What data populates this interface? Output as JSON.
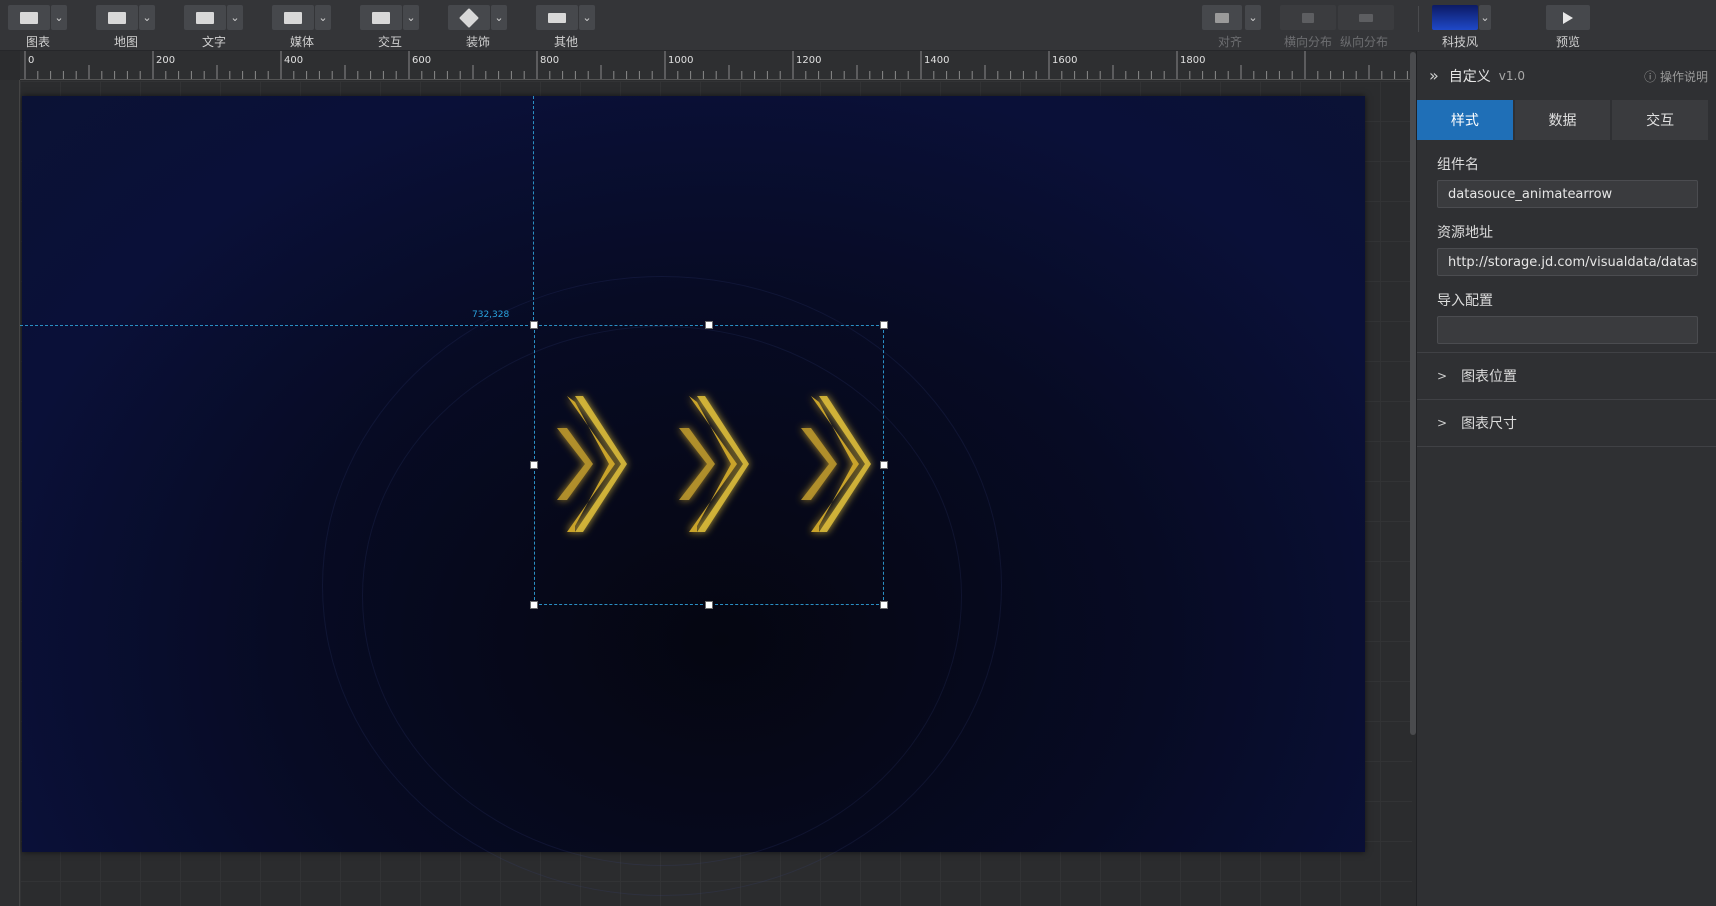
{
  "toolbar": {
    "tools": [
      {
        "label": "图表",
        "icon": "chart-icon"
      },
      {
        "label": "地图",
        "icon": "map-icon"
      },
      {
        "label": "文字",
        "icon": "text-icon"
      },
      {
        "label": "媒体",
        "icon": "media-icon"
      },
      {
        "label": "交互",
        "icon": "interaction-icon"
      },
      {
        "label": "装饰",
        "icon": "decoration-icon"
      },
      {
        "label": "其他",
        "icon": "more-icon"
      }
    ],
    "align_label": "对齐",
    "hdist_label": "横向分布",
    "vdist_label": "纵向分布",
    "theme_label": "科技风",
    "preview_label": "预览"
  },
  "ruler": {
    "ticks": [
      "0",
      "200",
      "400",
      "600",
      "800",
      "1000",
      "1200",
      "1400",
      "1600",
      "1800"
    ]
  },
  "canvas": {
    "coord_label": "732,328"
  },
  "panel": {
    "title": "自定义",
    "version": "v1.0",
    "help": "操作说明",
    "tabs": [
      "样式",
      "数据",
      "交互"
    ],
    "active_tab": "样式",
    "component_name_label": "组件名",
    "component_name_value": "datasouce_animatearrow",
    "resource_label": "资源地址",
    "resource_value": "http://storage.jd.com/visualdata/datas",
    "import_label": "导入配置",
    "import_value": "",
    "sections": [
      "图表位置",
      "图表尺寸"
    ]
  },
  "colors": {
    "accent": "#1f6fb7",
    "guide": "#2a8fc4",
    "arrow": "#d8b52a"
  }
}
